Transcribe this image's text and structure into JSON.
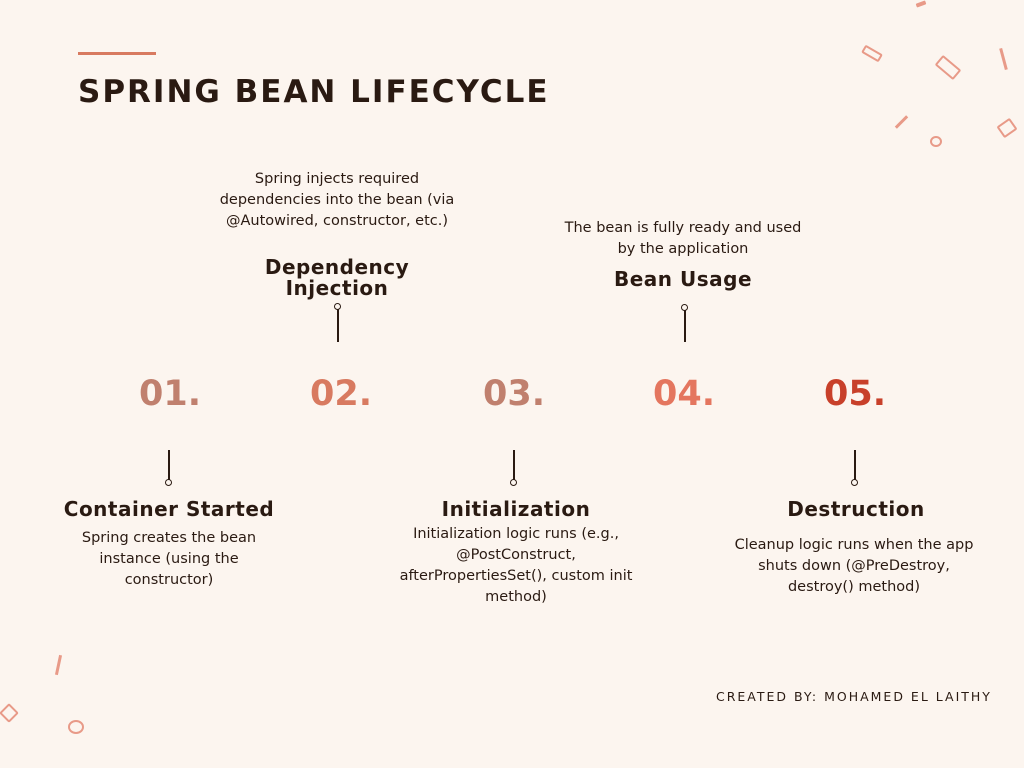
{
  "title": "SPRING BEAN LIFECYCLE",
  "credit": "CREATED BY: MOHAMED EL LAITHY",
  "colors": {
    "background": "#fcf5ef",
    "text": "#2a1a12",
    "accent": "#d87a60",
    "step_numbers": [
      "#c0806e",
      "#d87a60",
      "#c0806e",
      "#e4765f",
      "#c8402a"
    ]
  },
  "steps": [
    {
      "number": "01.",
      "title": "Container Started",
      "description": "Spring creates the bean instance (using the constructor)",
      "position": "below"
    },
    {
      "number": "02.",
      "title": "Dependency Injection",
      "description": "Spring injects required dependencies into the bean (via @Autowired, constructor, etc.)",
      "position": "above"
    },
    {
      "number": "03.",
      "title": "Initialization",
      "description": "Initialization logic runs (e.g., @PostConstruct, afterPropertiesSet(), custom init method)",
      "position": "below"
    },
    {
      "number": "04.",
      "title": "Bean Usage",
      "description": "The bean is fully ready and used by the application",
      "position": "above"
    },
    {
      "number": "05.",
      "title": "Destruction",
      "description": "Cleanup logic runs when the app shuts down (@PreDestroy, destroy() method)",
      "position": "below"
    }
  ]
}
